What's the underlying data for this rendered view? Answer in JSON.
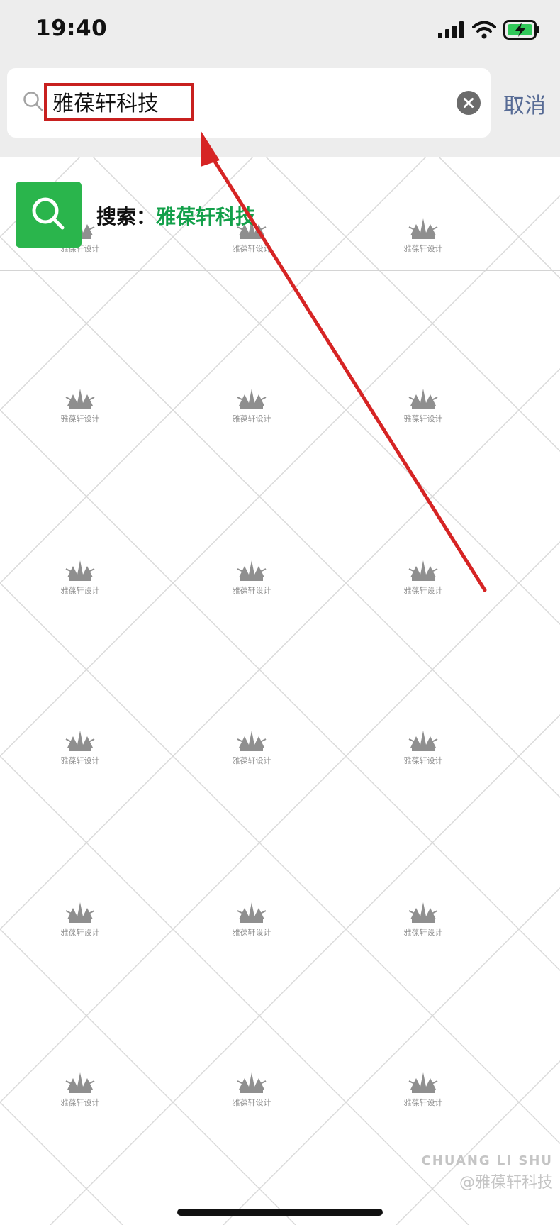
{
  "status_bar": {
    "time": "19:40"
  },
  "search": {
    "query": "雅葆轩科技",
    "cancel_label": "取消"
  },
  "result": {
    "prefix": "搜索：",
    "keyword": "雅葆轩科技"
  },
  "watermark": {
    "text": "雅葆轩设计",
    "footer_en": "CHUANG LI SHU",
    "footer_cn": "@雅葆轩科技"
  },
  "colors": {
    "header_bg": "#ededed",
    "accent_green": "#2ab54c",
    "keyword_green": "#13a04a",
    "link_blue": "#576b95",
    "annotation_red": "#d62424"
  },
  "icons": {
    "signal": "signal-icon",
    "wifi": "wifi-icon",
    "battery": "battery-charging-icon",
    "search": "search-icon",
    "clear": "clear-icon"
  }
}
